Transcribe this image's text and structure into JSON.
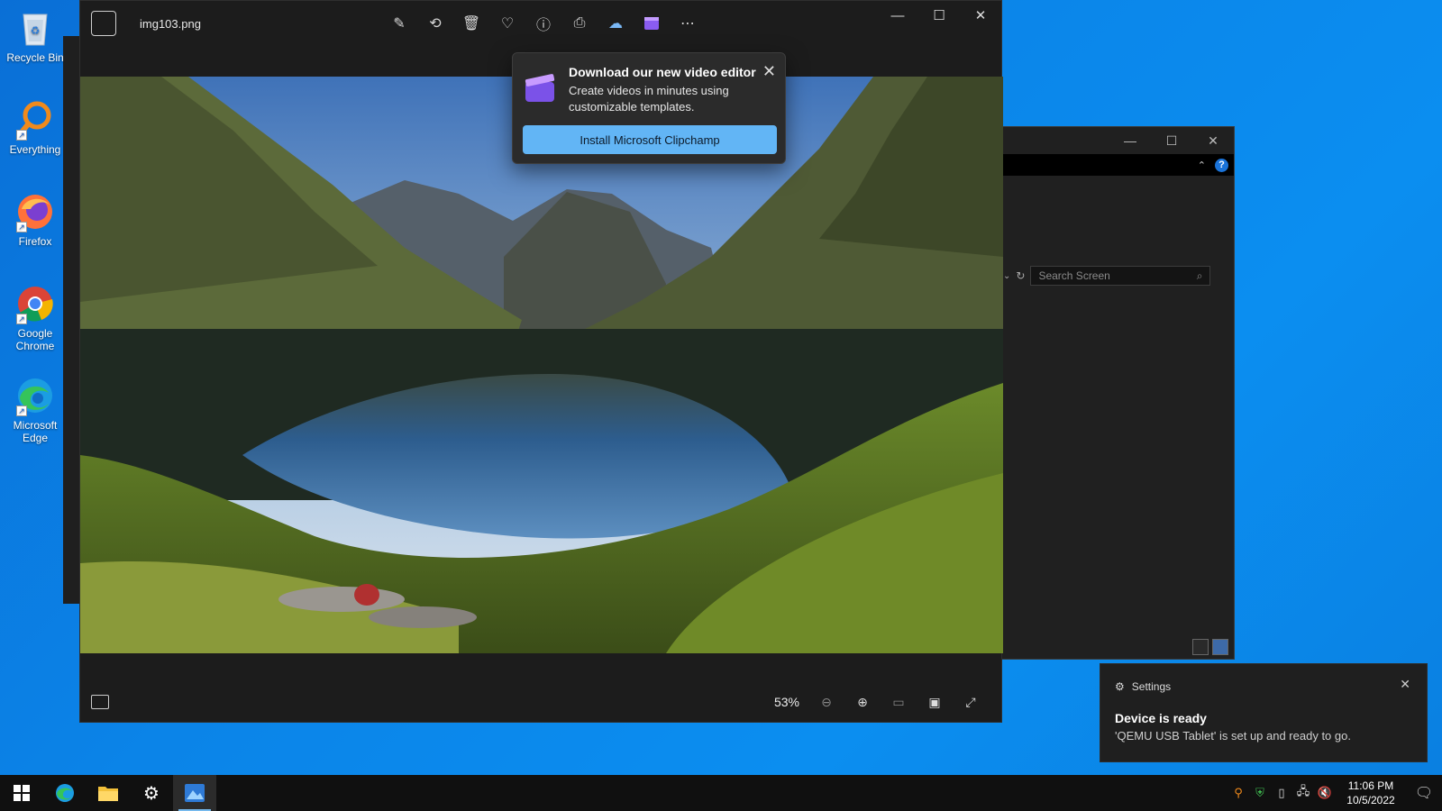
{
  "desktop": {
    "icons": [
      {
        "label": "Recycle Bin"
      },
      {
        "label": "Everything"
      },
      {
        "label": "Firefox"
      },
      {
        "label": "Google Chrome"
      },
      {
        "label": "Microsoft Edge"
      }
    ]
  },
  "photos": {
    "filename": "img103.png",
    "zoom": "53%",
    "tools": [
      "edit-icon",
      "rotate-icon",
      "delete-icon",
      "favorite-icon",
      "info-icon",
      "print-icon",
      "onedrive-icon",
      "clipchamp-icon",
      "more-icon"
    ]
  },
  "popup": {
    "title": "Download our new video editor",
    "description": "Create videos in minutes using customizable templates.",
    "button": "Install Microsoft Clipchamp"
  },
  "bg_window": {
    "search_placeholder": "Search Screen"
  },
  "toast": {
    "app": "Settings",
    "title": "Device is ready",
    "body": "'QEMU USB Tablet' is set up and ready to go."
  },
  "taskbar": {
    "time": "11:06 PM",
    "date": "10/5/2022"
  }
}
